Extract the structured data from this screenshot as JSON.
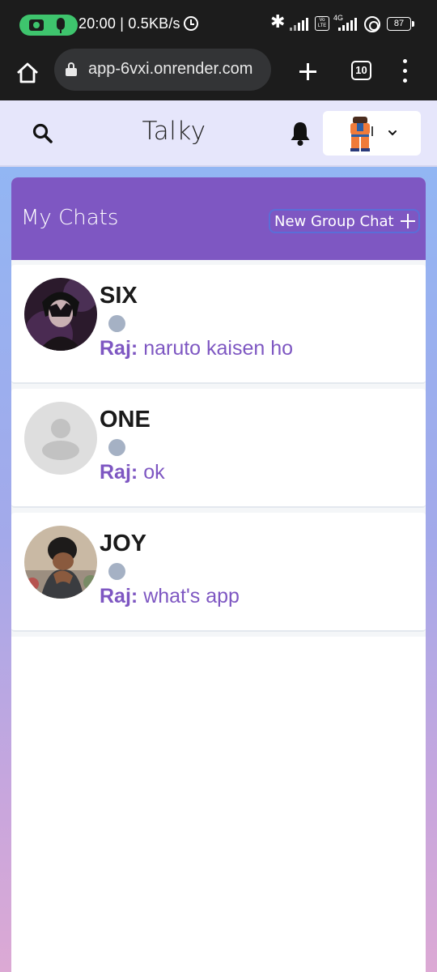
{
  "status_bar": {
    "time_speed": "20:00 | 0.5KB/s",
    "volte": "Vo LTE",
    "network": "4G",
    "battery": "87"
  },
  "browser": {
    "url": "app-6vxi.onrender.com",
    "tab_count": "10"
  },
  "header": {
    "title": "Talky"
  },
  "chats": {
    "title": "My Chats",
    "new_group_label": "New Group Chat",
    "items": [
      {
        "name": "SIX",
        "sender": "Raj:",
        "message": "naruto kaisen ho"
      },
      {
        "name": "ONE",
        "sender": "Raj:",
        "message": "ok"
      },
      {
        "name": "JOY",
        "sender": "Raj:",
        "message": "what's app"
      }
    ]
  },
  "colors": {
    "accent_purple": "#7e57c2",
    "header_bg": "#e6e6fb",
    "status_dot": "#a5b1c4",
    "record_pill": "#3ec46d"
  }
}
